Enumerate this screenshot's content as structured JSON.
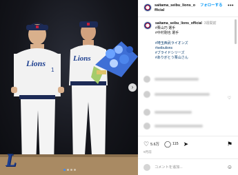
{
  "post": {
    "photo_alt": "",
    "team_logo_letter": "L",
    "next_glyph": "›",
    "carousel_dots": 4
  },
  "header": {
    "username": "saitama_seibu_lions_official",
    "follow_label": "フォローする",
    "more_label": "•••"
  },
  "caption": {
    "username": "saitama_seibu_lions_official",
    "time": "3週間前",
    "lines": [
      "#栗山巧 選手",
      "#中村剛也 選手"
    ],
    "hashtags": [
      "#埼玉西武ライオンズ",
      "#seibulions",
      "#ブライドシリーズ",
      "#ありがとう栗山さん"
    ]
  },
  "actions": {
    "likes": "5.6万",
    "comments": "115",
    "like_icon": "heart-icon",
    "comment_icon": "comment-icon",
    "share_icon": "share-icon",
    "save_icon": "bookmark-icon",
    "date": "9月前"
  },
  "comment_box": {
    "placeholder": "コメントを追加...",
    "emoji_icon": "smile-icon"
  }
}
